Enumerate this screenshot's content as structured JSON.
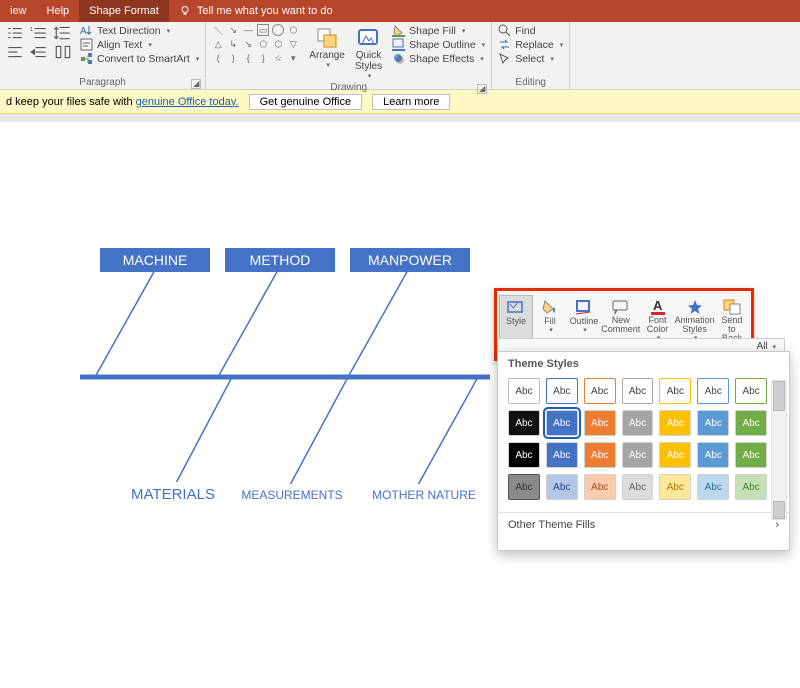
{
  "tabs": {
    "view": "iew",
    "help": "Help",
    "shape_format": "Shape Format",
    "tell_me": "Tell me what you want to do"
  },
  "ribbon": {
    "paragraph": {
      "text_direction": "Text Direction",
      "align_text": "Align Text",
      "convert_smartart": "Convert to SmartArt",
      "label": "Paragraph"
    },
    "drawing": {
      "arrange": "Arrange",
      "quick_styles": "Quick\nStyles",
      "shape_fill": "Shape Fill",
      "shape_outline": "Shape Outline",
      "shape_effects": "Shape Effects",
      "label": "Drawing"
    },
    "editing": {
      "find": "Find",
      "replace": "Replace",
      "select": "Select",
      "label": "Editing"
    }
  },
  "msgbar": {
    "text_left": "d keep your files safe with ",
    "link": "genuine Office today.",
    "btn1": "Get genuine Office",
    "btn2": "Learn more"
  },
  "fishbone": {
    "top": [
      "MACHINE",
      "METHOD",
      "MANPOWER"
    ],
    "bottom": [
      "MATERIALS",
      "MEASUREMENTS",
      "MOTHER NATURE"
    ]
  },
  "popup": {
    "tools": [
      "Style",
      "Fill",
      "Outline",
      "New\nComment",
      "Font\nColor",
      "Animation\nStyles",
      "Send to\nBack"
    ],
    "all": "All"
  },
  "themes": {
    "title": "Theme Styles",
    "footer": "Other Theme Fills",
    "colors": {
      "row1": [
        {
          "bg": "#ffffff",
          "fg": "#444",
          "border": "#bcbcbc"
        },
        {
          "bg": "#ffffff",
          "fg": "#444",
          "border": "#4472C4"
        },
        {
          "bg": "#ffffff",
          "fg": "#444",
          "border": "#ED7D31"
        },
        {
          "bg": "#ffffff",
          "fg": "#444",
          "border": "#A5A5A5"
        },
        {
          "bg": "#ffffff",
          "fg": "#444",
          "border": "#FFC000"
        },
        {
          "bg": "#ffffff",
          "fg": "#444",
          "border": "#5B9BD5"
        },
        {
          "bg": "#ffffff",
          "fg": "#444",
          "border": "#70AD47"
        }
      ],
      "row2": [
        {
          "bg": "#111111",
          "fg": "#fff"
        },
        {
          "bg": "#4472C4",
          "fg": "#fff",
          "sel": true
        },
        {
          "bg": "#ED7D31",
          "fg": "#fff"
        },
        {
          "bg": "#A5A5A5",
          "fg": "#fff"
        },
        {
          "bg": "#FFC000",
          "fg": "#fff"
        },
        {
          "bg": "#5B9BD5",
          "fg": "#fff"
        },
        {
          "bg": "#70AD47",
          "fg": "#fff"
        }
      ],
      "row3": [
        {
          "bg": "#000000",
          "fg": "#fff"
        },
        {
          "bg": "#4472C4",
          "fg": "#fff"
        },
        {
          "bg": "#ED7D31",
          "fg": "#fff"
        },
        {
          "bg": "#A5A5A5",
          "fg": "#fff"
        },
        {
          "bg": "#FFC000",
          "fg": "#fff"
        },
        {
          "bg": "#5B9BD5",
          "fg": "#fff"
        },
        {
          "bg": "#70AD47",
          "fg": "#fff"
        }
      ],
      "row4": [
        {
          "bg": "#8a8a8a",
          "fg": "#333",
          "border": "#555"
        },
        {
          "bg": "#B4C7E7",
          "fg": "#2c4a8a"
        },
        {
          "bg": "#F8CBAD",
          "fg": "#a84a1a"
        },
        {
          "bg": "#dcdcdc",
          "fg": "#666"
        },
        {
          "bg": "#FFE699",
          "fg": "#a37a00"
        },
        {
          "bg": "#BDD7EE",
          "fg": "#2e6ca3"
        },
        {
          "bg": "#C5E0B4",
          "fg": "#4a7a2e"
        }
      ]
    },
    "abc": "Abc"
  }
}
